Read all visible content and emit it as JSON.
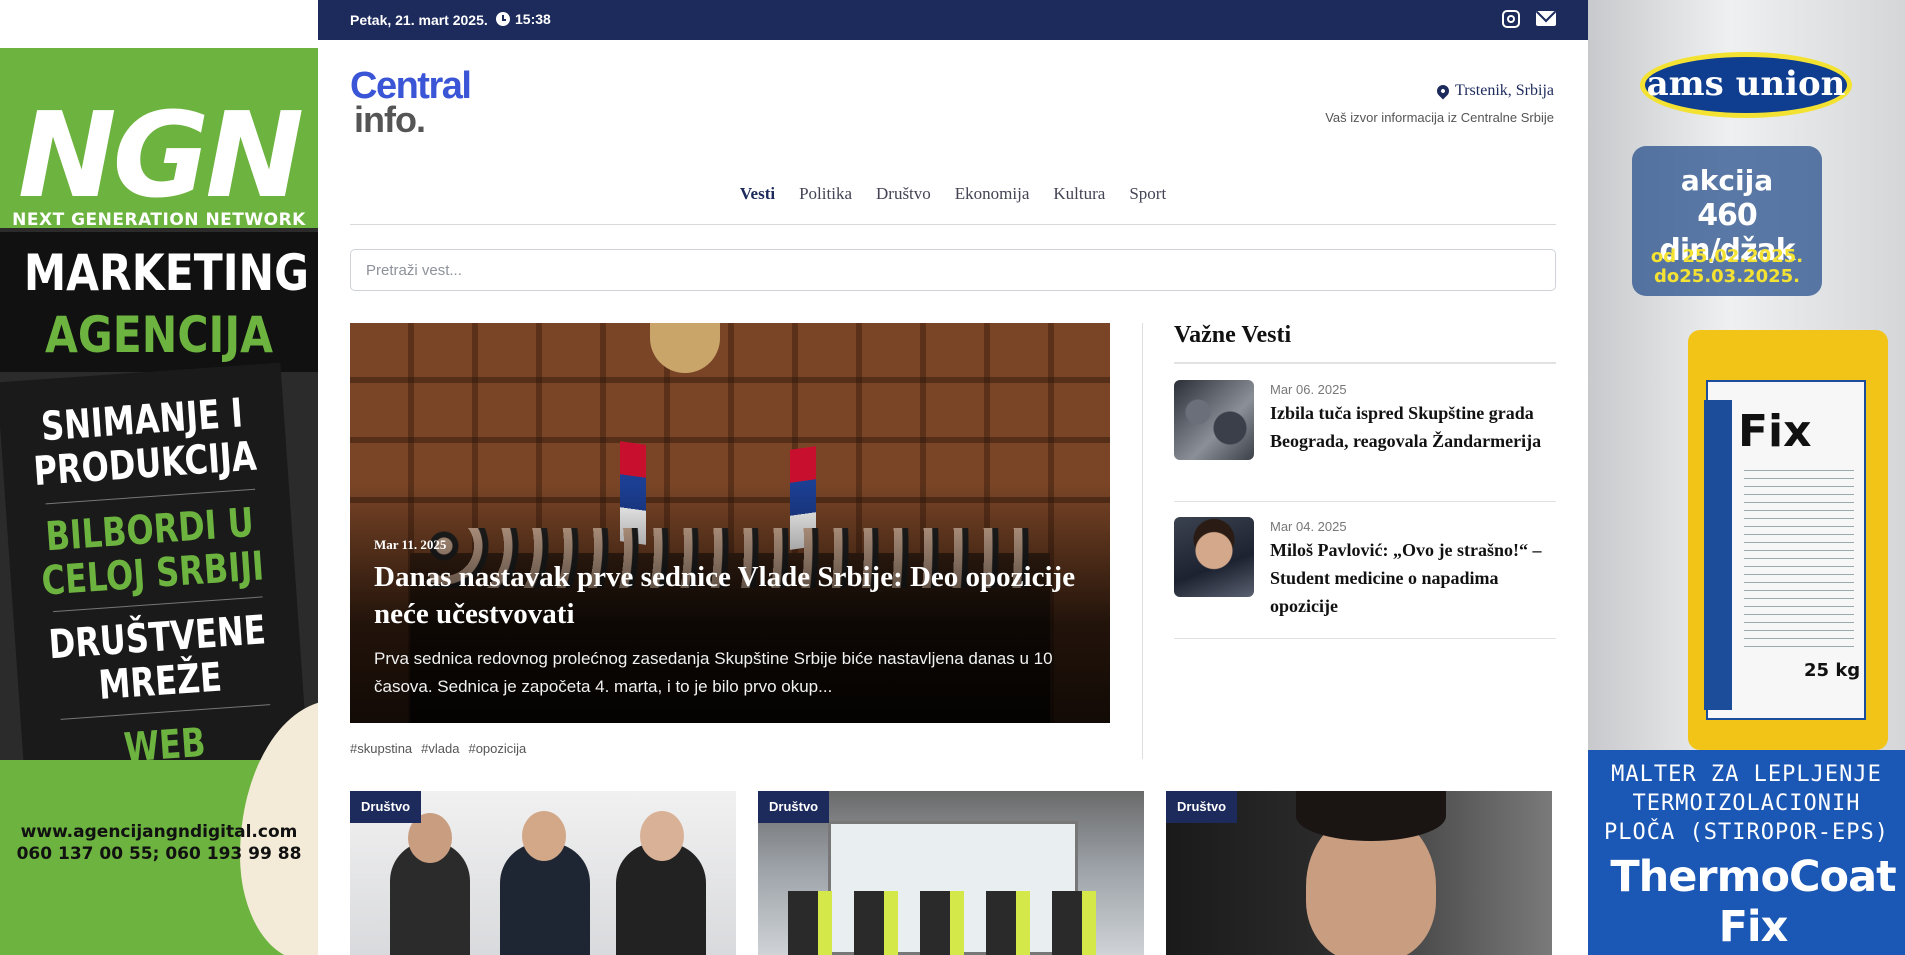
{
  "ad_left": {
    "logo": "NGN",
    "logo_sub": "NEXT GENERATION NETWORK",
    "line1": "MARKETING",
    "line2": "AGENCIJA",
    "services": [
      "SNIMANJE I",
      "PRODUKCIJA",
      "BILBORDI U",
      "CELOJ SRBIJI",
      "DRUŠTVENE",
      "MREŽE",
      "WEB SAJTOVI"
    ],
    "url": "www.agencijangndigital.com",
    "phones": "060 137 00 55; 060 193 99 88"
  },
  "ad_right": {
    "brand": "ams union",
    "promo_word": "akcija",
    "promo_price": "460 din/džak",
    "date_from": "od 25.02.2025.",
    "date_to": "do25.03.2025.",
    "product": "Fix",
    "product_weight": "25 kg",
    "description_lines": [
      "MALTER ZA LEPLJENJE",
      "TERMOIZOLACIONIH",
      "PLOČA (STIROPOR-EPS)"
    ],
    "product_name": "ThermoCoat Fix"
  },
  "topbar": {
    "date": "Petak, 21. mart 2025.",
    "time": "15:38"
  },
  "header": {
    "logo_line1": "Central",
    "logo_line2": "info.",
    "location": "Trstenik, Srbija",
    "tagline": "Vaš izvor informacija iz Centralne Srbije"
  },
  "nav": {
    "items": [
      "Vesti",
      "Politika",
      "Društvo",
      "Ekonomija",
      "Kultura",
      "Sport"
    ]
  },
  "search": {
    "placeholder": "Pretraži vest..."
  },
  "hero": {
    "date": "Mar 11. 2025",
    "title": "Danas nastavak prve sednice Vlade Srbije: Deo opozicije neće učestvovati",
    "excerpt": "Prva sednica redovnog prolećnog zasedanja Skupštine Srbije biće nastavljena danas u 10 časova. Sednica je započeta 4. marta, i to je bilo prvo okup...",
    "tags": [
      "#skupstina",
      "#vlada",
      "#opozicija"
    ]
  },
  "sidebar": {
    "title": "Važne Vesti",
    "items": [
      {
        "date": "Mar 06. 2025",
        "title": "Izbila tuča ispred Skupštine grada Beograda, reagovala Žandarmerija"
      },
      {
        "date": "Mar 04. 2025",
        "title": "Miloš Pavlović: „Ovo je strašno!“ – Student medicine o napadima opozicije"
      }
    ]
  },
  "cards": [
    {
      "category": "Društvo"
    },
    {
      "category": "Društvo"
    },
    {
      "category": "Društvo"
    }
  ],
  "colors": {
    "navy": "#1c2a5c",
    "logo_blue": "#3a55d6",
    "ngn_green": "#6db33f",
    "sika_yellow": "#f2c418"
  }
}
